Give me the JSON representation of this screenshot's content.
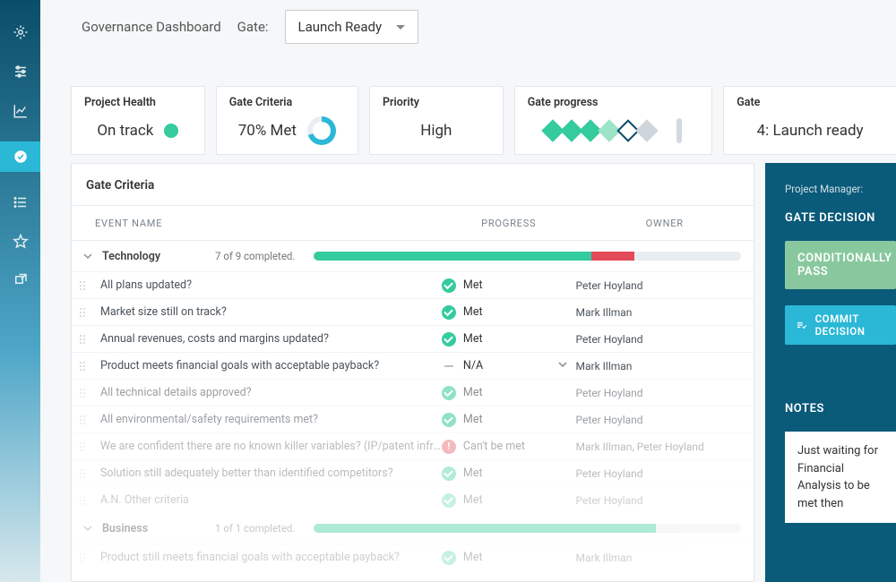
{
  "header": {
    "title": "Governance Dashboard",
    "gate_label": "Gate:",
    "gate_selected": "Launch Ready"
  },
  "cards": {
    "health": {
      "label": "Project Health",
      "value": "On track"
    },
    "criteria": {
      "label": "Gate Criteria",
      "value": "70% Met"
    },
    "priority": {
      "label": "Priority",
      "value": "High"
    },
    "progress": {
      "label": "Gate progress"
    },
    "gate": {
      "label": "Gate",
      "value": "4: Launch ready"
    }
  },
  "gate_diamonds": [
    "fill",
    "fill",
    "fill",
    "light",
    "outline",
    "grey"
  ],
  "panel": {
    "title": "Gate Criteria",
    "columns": {
      "name": "EVENT NAME",
      "progress": "PROGRESS",
      "owner": "OWNER"
    }
  },
  "groups": [
    {
      "name": "Technology",
      "count_text": "7 of 9 completed.",
      "bar": [
        {
          "pct": 65,
          "color": "#34cb9e"
        },
        {
          "pct": 10,
          "color": "#e34a5a"
        }
      ],
      "rows": [
        {
          "name": "All plans updated?",
          "status": "met",
          "status_text": "Met",
          "owner": "Peter Hoyland",
          "fade": ""
        },
        {
          "name": "Market size still on track?",
          "status": "met",
          "status_text": "Met",
          "owner": "Mark Illman",
          "fade": ""
        },
        {
          "name": "Annual revenues, costs and margins updated?",
          "status": "met",
          "status_text": "Met",
          "owner": "Peter Hoyland",
          "fade": ""
        },
        {
          "name": "Product meets financial goals with acceptable payback?",
          "status": "na",
          "status_text": "N/A",
          "owner": "Mark Illman",
          "fade": "",
          "dropdown": true
        },
        {
          "name": "All technical details approved?",
          "status": "met",
          "status_text": "Met",
          "owner": "Peter Hoyland",
          "fade": "fadeA"
        },
        {
          "name": "All environmental/safety requirements met?",
          "status": "met",
          "status_text": "Met",
          "owner": "Peter Hoyland",
          "fade": "fadeA"
        },
        {
          "name": "We are confident there are no known killer variables? (IP/patent infri…",
          "status": "cant",
          "status_text": "Can't be met",
          "owner": "Mark Illman, Peter Hoyland",
          "fade": "fadeB"
        },
        {
          "name": "Solution still adequately better than identified competitors?",
          "status": "met",
          "status_text": "Met",
          "owner": "Peter Hoyland",
          "fade": "fadeB"
        },
        {
          "name": "A.N. Other criteria",
          "status": "met",
          "status_text": "Met",
          "owner": "Peter Hoyland",
          "fade": "fadeC"
        }
      ]
    },
    {
      "name": "Business",
      "count_text": "1 of 1 completed.",
      "fade": true,
      "bar": [
        {
          "pct": 80,
          "color": "#34cb9e"
        }
      ],
      "rows": [
        {
          "name": "Product still meets financial goals with acceptable payback?",
          "status": "met",
          "status_text": "Met",
          "owner": "Mark Illman",
          "fade": "fadeC"
        }
      ]
    }
  ],
  "side": {
    "pm_label": "Project Manager:",
    "decision_heading": "GATE DECISION",
    "conditional": "CONDITIONALLY PASS",
    "commit": "COMMIT DECISION",
    "notes_heading": "NOTES",
    "notes_text": "Just waiting for Financial Analysis to be met then"
  },
  "nav_icons": [
    "gear",
    "sliders",
    "chart",
    "check",
    "list",
    "star",
    "export"
  ],
  "nav_active_index": 3
}
